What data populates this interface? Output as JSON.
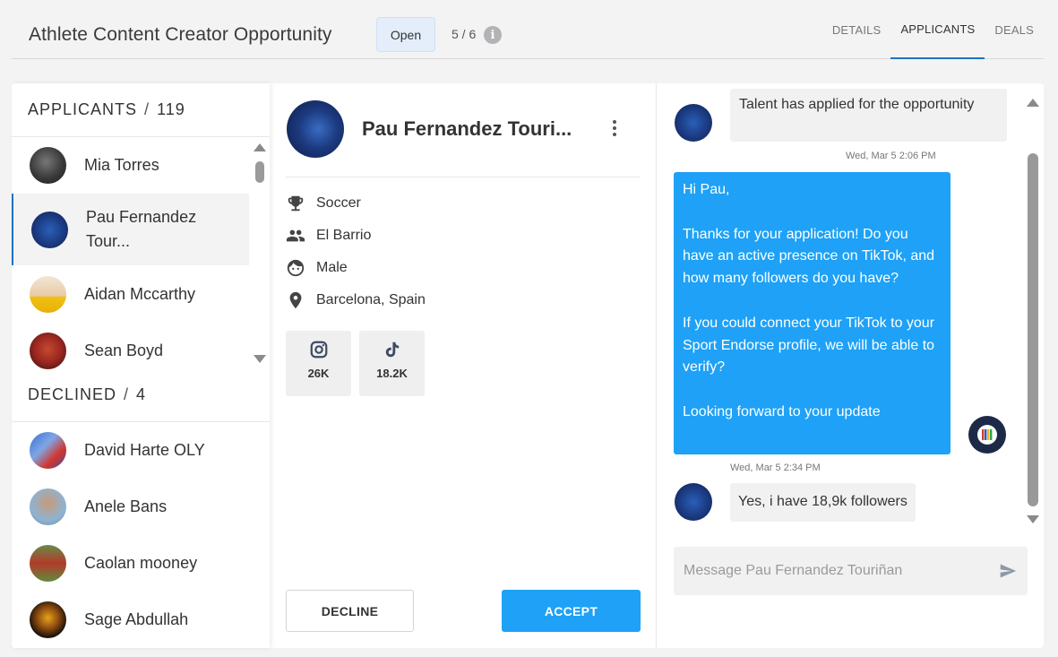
{
  "header": {
    "title": "Athlete Content Creator Opportunity",
    "status": "Open",
    "slots": "5 / 6",
    "info_icon": "info-icon",
    "tabs": [
      {
        "label": "DETAILS",
        "active": false
      },
      {
        "label": "APPLICANTS",
        "active": true
      },
      {
        "label": "DEALS",
        "active": false
      }
    ]
  },
  "applicants": {
    "label": "APPLICANTS",
    "count": "119",
    "items": [
      {
        "name": "Mia Torres"
      },
      {
        "name": "Pau Fernandez Tour...",
        "selected": true
      },
      {
        "name": "Aidan Mccarthy"
      },
      {
        "name": "Sean Boyd"
      }
    ]
  },
  "declined": {
    "label": "DECLINED",
    "count": "4",
    "items": [
      {
        "name": "David Harte OLY"
      },
      {
        "name": "Anele Bans"
      },
      {
        "name": "Caolan mooney"
      },
      {
        "name": "Sage Abdullah"
      }
    ]
  },
  "profile": {
    "name": "Pau Fernandez Touri...",
    "attributes": [
      {
        "icon": "trophy-icon",
        "text": "Soccer"
      },
      {
        "icon": "people-icon",
        "text": "El Barrio"
      },
      {
        "icon": "face-icon",
        "text": "Male"
      },
      {
        "icon": "location-pin-icon",
        "text": "Barcelona, Spain"
      }
    ],
    "socials": [
      {
        "icon": "instagram-icon",
        "followers": "26K"
      },
      {
        "icon": "tiktok-icon",
        "followers": "18.2K"
      }
    ],
    "decline_label": "DECLINE",
    "accept_label": "ACCEPT"
  },
  "chat": {
    "messages": [
      {
        "from": "talent",
        "text": "Talent has applied for the opportunity"
      },
      {
        "timestamp": "Wed, Mar 5 2:06 PM"
      },
      {
        "from": "brand",
        "text": "Hi Pau,\n\nThanks for your application! Do you have an active presence on TikTok, and how many followers do you have?\n\nIf you could connect your TikTok to your Sport Endorse profile, we will be able to verify?\n\nLooking forward to your update"
      },
      {
        "timestamp": "Wed, Mar 5 2:34 PM"
      },
      {
        "from": "talent",
        "text": "Yes, i have 18,9k followers"
      }
    ],
    "input_placeholder": "Message Pau Fernandez Touriñan",
    "send_icon": "send-icon"
  },
  "colors": {
    "accent": "#1ea1f6",
    "tab_underline": "#1e73be",
    "pill_bg": "#e3eefa"
  }
}
